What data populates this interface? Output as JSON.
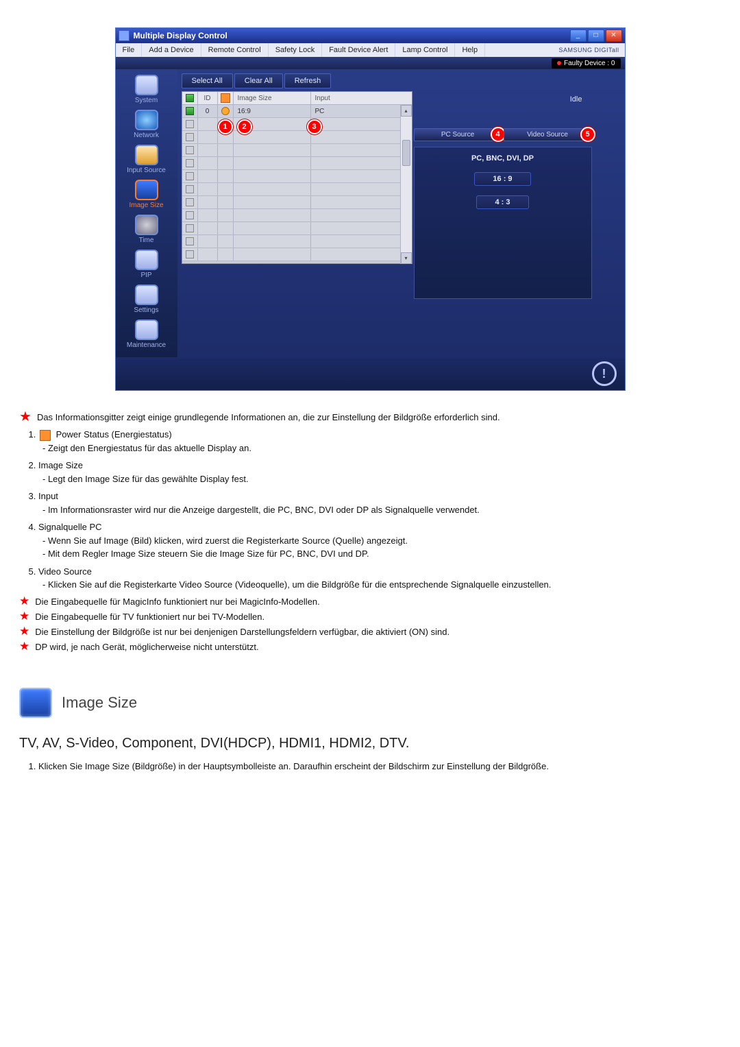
{
  "window": {
    "title": "Multiple Display Control",
    "brand": "SAMSUNG DIGITall"
  },
  "menu": [
    "File",
    "Add a Device",
    "Remote Control",
    "Safety Lock",
    "Fault Device Alert",
    "Lamp Control",
    "Help"
  ],
  "faulty_label": "Faulty Device : 0",
  "sidebar": [
    {
      "label": "System",
      "icon": "plain"
    },
    {
      "label": "Network",
      "icon": "net"
    },
    {
      "label": "Input Source",
      "icon": "input"
    },
    {
      "label": "Image Size",
      "icon": "img",
      "active": true
    },
    {
      "label": "Time",
      "icon": "time"
    },
    {
      "label": "PIP",
      "icon": "plain"
    },
    {
      "label": "Settings",
      "icon": "plain"
    },
    {
      "label": "Maintenance",
      "icon": "plain"
    }
  ],
  "toolbar": {
    "select_all": "Select All",
    "clear_all": "Clear All",
    "refresh": "Refresh",
    "idle": "Idle"
  },
  "table": {
    "headers": {
      "id": "ID",
      "size": "Image Size",
      "input": "Input"
    },
    "rows": [
      {
        "checked": true,
        "id": "0",
        "power": "on",
        "size": "16:9",
        "input": "PC",
        "sel": true
      },
      {
        "checked": false,
        "id": "",
        "power": "",
        "size": "",
        "input": ""
      },
      {
        "checked": false,
        "id": "",
        "power": "",
        "size": "",
        "input": ""
      },
      {
        "checked": false,
        "id": "",
        "power": "",
        "size": "",
        "input": ""
      },
      {
        "checked": false,
        "id": "",
        "power": "",
        "size": "",
        "input": ""
      },
      {
        "checked": false,
        "id": "",
        "power": "",
        "size": "",
        "input": ""
      },
      {
        "checked": false,
        "id": "",
        "power": "",
        "size": "",
        "input": ""
      },
      {
        "checked": false,
        "id": "",
        "power": "",
        "size": "",
        "input": ""
      },
      {
        "checked": false,
        "id": "",
        "power": "",
        "size": "",
        "input": ""
      },
      {
        "checked": false,
        "id": "",
        "power": "",
        "size": "",
        "input": ""
      },
      {
        "checked": false,
        "id": "",
        "power": "",
        "size": "",
        "input": ""
      },
      {
        "checked": false,
        "id": "",
        "power": "",
        "size": "",
        "input": ""
      }
    ]
  },
  "tabs": {
    "pc": "PC Source",
    "video": "Video Source"
  },
  "source": {
    "label": "PC, BNC, DVI, DP",
    "opt1": "16 : 9",
    "opt2": "4 : 3"
  },
  "callouts": {
    "c1": "1",
    "c2": "2",
    "c3": "3",
    "c4": "4",
    "c5": "5"
  },
  "doc": {
    "intro": "Das Informationsgitter zeigt einige grundlegende Informationen an, die zur Einstellung der Bildgröße erforderlich sind.",
    "items": {
      "i1_head": "Power Status (Energiestatus)",
      "i1_sub": "- Zeigt den Energiestatus für das aktuelle Display an.",
      "i2_head": "Image Size",
      "i2_sub": "- Legt den Image Size für das gewählte Display fest.",
      "i3_head": "Input",
      "i3_sub": "- Im Informationsraster wird nur die Anzeige dargestellt, die PC, BNC, DVI oder DP als Signalquelle verwendet.",
      "i4_head": "Signalquelle PC",
      "i4_sub1": "- Wenn Sie auf Image (Bild) klicken, wird zuerst die Registerkarte Source (Quelle) angezeigt.",
      "i4_sub2": "- Mit dem Regler Image Size steuern Sie die Image Size für PC, BNC, DVI und DP.",
      "i5_head": "Video Source",
      "i5_sub": "- Klicken Sie auf die Registerkarte Video Source (Videoquelle), um die Bildgröße für die entsprechende Signalquelle einzustellen."
    },
    "notes": [
      "Die Eingabequelle für MagicInfo funktioniert nur bei MagicInfo-Modellen.",
      "Die Eingabequelle für TV funktioniert nur bei TV-Modellen.",
      "Die Einstellung der Bildgröße ist nur bei denjenigen Darstellungsfeldern verfügbar, die aktiviert (ON) sind.",
      "DP wird, je nach Gerät, möglicherweise nicht unterstützt."
    ],
    "section_title": "Image Size",
    "subtitle": "TV, AV, S-Video, Component, DVI(HDCP), HDMI1, HDMI2, DTV.",
    "step1": "Klicken Sie Image Size (Bildgröße) in der Hauptsymbolleiste an. Daraufhin erscheint der Bildschirm zur Einstellung der Bildgröße."
  }
}
